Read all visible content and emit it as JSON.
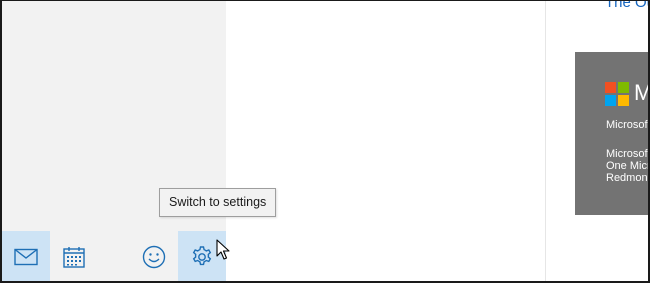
{
  "app": {
    "bottom_bar": [
      {
        "name": "mail-button",
        "icon": "mail-icon",
        "selected": true
      },
      {
        "name": "calendar-button",
        "icon": "calendar-icon",
        "selected": false
      },
      {
        "name": "feedback-button",
        "icon": "smiley-icon",
        "selected": false
      },
      {
        "name": "settings-button",
        "icon": "gear-icon",
        "selected": true
      }
    ],
    "tooltip": "Switch to settings",
    "accent_color": "#1e6fb5",
    "selected_bg": "#cde3f5"
  },
  "reading_pane": {
    "top_link": "The Ou",
    "card": {
      "logo_word": "M",
      "line1": "Microsof",
      "line2": "Microsof",
      "line3": "One Micr",
      "line4": "Redmon",
      "background": "#737373",
      "logo_colors": [
        "#f25022",
        "#7fba00",
        "#00a4ef",
        "#ffb900"
      ]
    }
  }
}
